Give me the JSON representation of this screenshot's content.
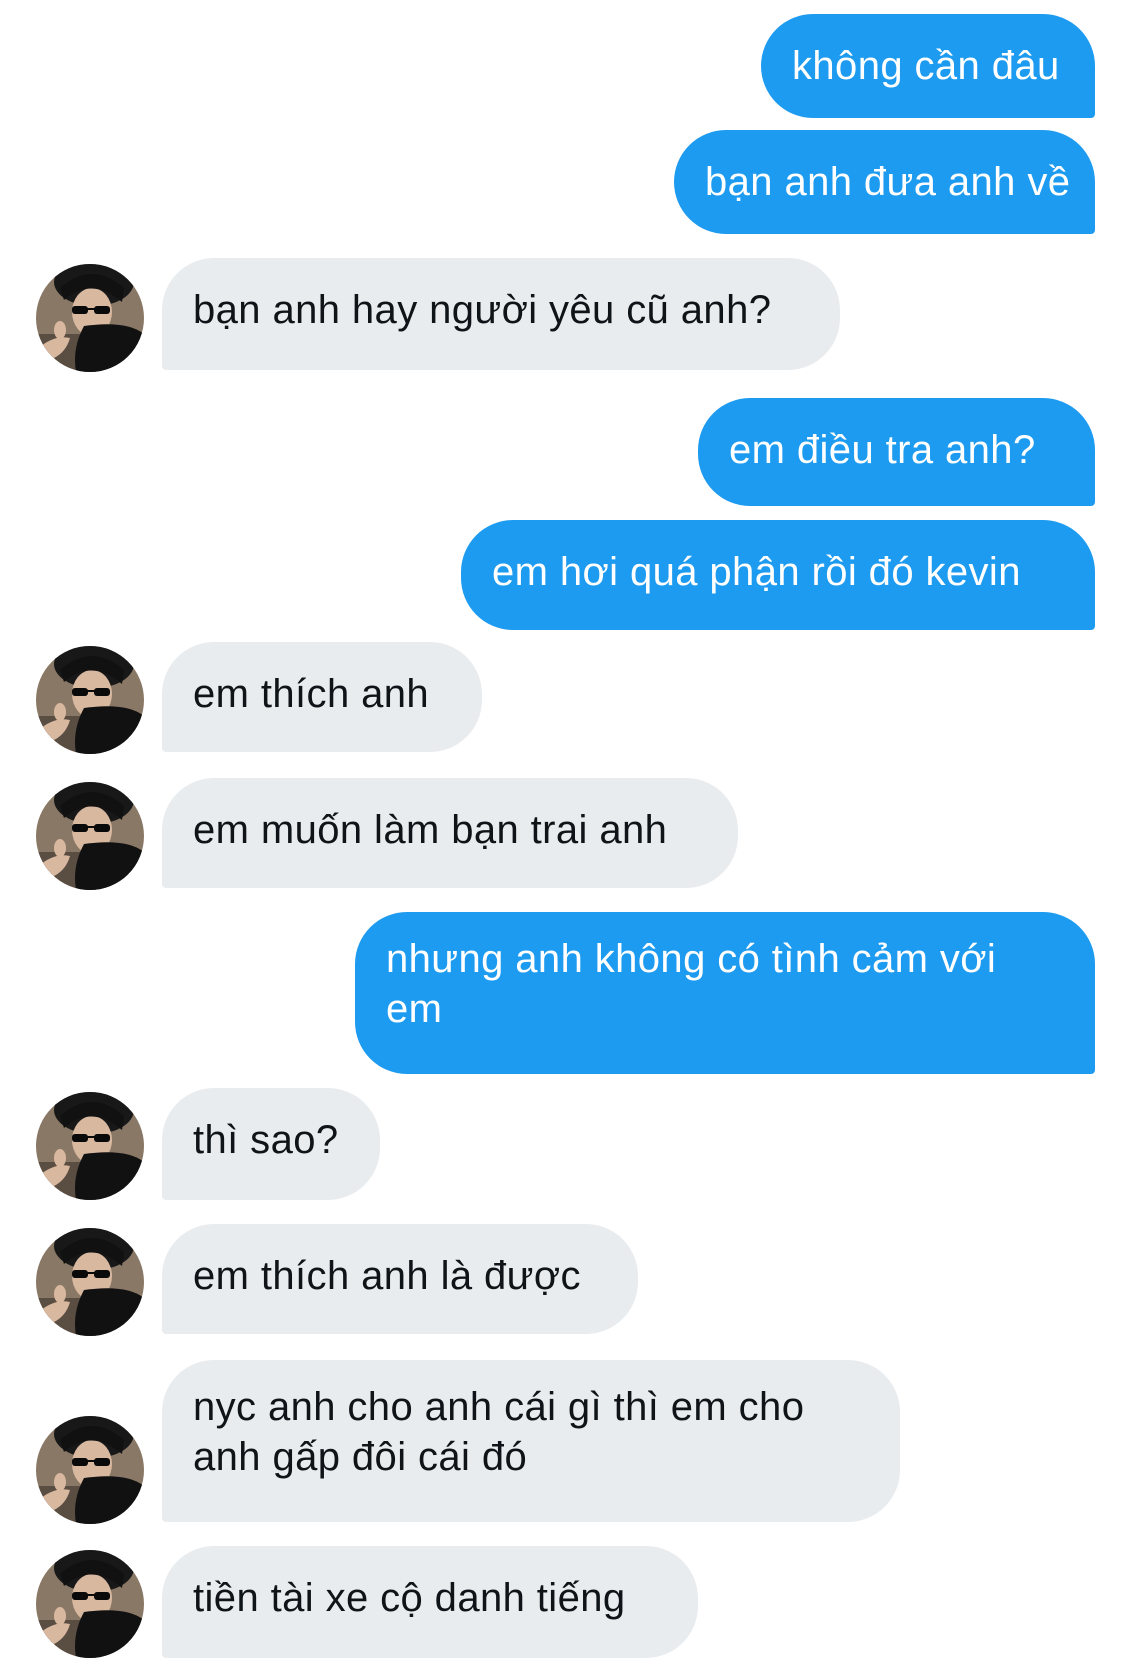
{
  "conversation": {
    "messages": [
      {
        "side": "sent",
        "text": "không cần đâu"
      },
      {
        "side": "sent",
        "text": "bạn anh đưa anh về"
      },
      {
        "side": "received",
        "text": "bạn anh hay người yêu cũ anh?"
      },
      {
        "side": "sent",
        "text": "em điều tra anh?"
      },
      {
        "side": "sent",
        "text": "em hơi quá phận rồi đó kevin"
      },
      {
        "side": "received",
        "text": "em thích anh"
      },
      {
        "side": "received",
        "text": "em muốn làm bạn trai anh"
      },
      {
        "side": "sent",
        "text": "nhưng anh không có tình cảm với em"
      },
      {
        "side": "received",
        "text": "thì sao?"
      },
      {
        "side": "received",
        "text": "em thích anh là được"
      },
      {
        "side": "received",
        "text": "nyc anh cho anh cái gì thì em cho anh gấp đôi cái đó"
      },
      {
        "side": "received",
        "text": "tiền tài xe cộ danh tiếng"
      }
    ]
  },
  "colors": {
    "sent_bubble": "#1d9bf0",
    "sent_text": "#ffffff",
    "received_bubble": "#e9ecef",
    "received_text": "#0f1419"
  },
  "icons": {
    "avatar": "contact-avatar-photo"
  }
}
